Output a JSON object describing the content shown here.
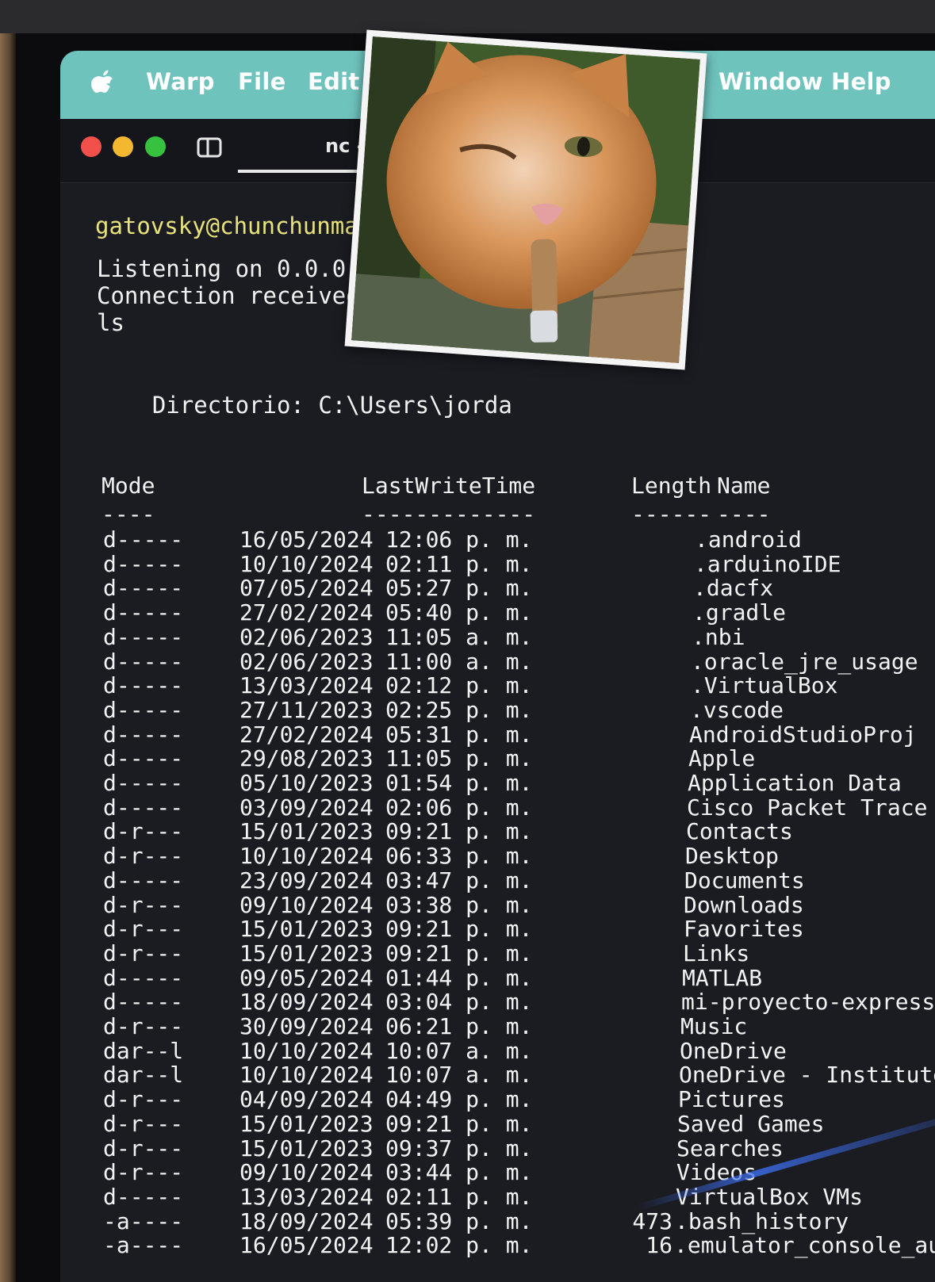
{
  "menubar": {
    "apple_icon": "apple-logo-icon",
    "items": [
      "Warp",
      "File",
      "Edit",
      "Window",
      "Help"
    ]
  },
  "tabbar": {
    "buttons": [
      {
        "name": "close",
        "color": "#f1514a"
      },
      {
        "name": "minimize",
        "color": "#f4b830"
      },
      {
        "name": "zoom",
        "color": "#36c13f"
      }
    ],
    "split_icon": "split-pane-icon",
    "active_tab": "nc -lv"
  },
  "terminal": {
    "prompt": "gatovsky@chunchunmaru",
    "lines": [
      "Listening on 0.0.0.0",
      "Connection received",
      "ls"
    ],
    "directory": "    Directorio: C:\\Users\\jorda",
    "columns": {
      "mode": "Mode",
      "time": "LastWriteTime",
      "length": "Length",
      "name": "Name"
    },
    "separators": {
      "mode": "----",
      "time": "-------------",
      "length": "------",
      "name": "----"
    },
    "rows": [
      {
        "mode": "d-----",
        "date": "16/05/2024",
        "time": "12:06 p. m.",
        "length": "",
        "name": ".android"
      },
      {
        "mode": "d-----",
        "date": "10/10/2024",
        "time": "02:11 p. m.",
        "length": "",
        "name": ".arduinoIDE"
      },
      {
        "mode": "d-----",
        "date": "07/05/2024",
        "time": "05:27 p. m.",
        "length": "",
        "name": ".dacfx"
      },
      {
        "mode": "d-----",
        "date": "27/02/2024",
        "time": "05:40 p. m.",
        "length": "",
        "name": ".gradle"
      },
      {
        "mode": "d-----",
        "date": "02/06/2023",
        "time": "11:05 a. m.",
        "length": "",
        "name": ".nbi"
      },
      {
        "mode": "d-----",
        "date": "02/06/2023",
        "time": "11:00 a. m.",
        "length": "",
        "name": ".oracle_jre_usage"
      },
      {
        "mode": "d-----",
        "date": "13/03/2024",
        "time": "02:12 p. m.",
        "length": "",
        "name": ".VirtualBox"
      },
      {
        "mode": "d-----",
        "date": "27/11/2023",
        "time": "02:25 p. m.",
        "length": "",
        "name": ".vscode"
      },
      {
        "mode": "d-----",
        "date": "27/02/2024",
        "time": "05:31 p. m.",
        "length": "",
        "name": "AndroidStudioProj"
      },
      {
        "mode": "d-----",
        "date": "29/08/2023",
        "time": "11:05 p. m.",
        "length": "",
        "name": "Apple"
      },
      {
        "mode": "d-----",
        "date": "05/10/2023",
        "time": "01:54 p. m.",
        "length": "",
        "name": "Application Data"
      },
      {
        "mode": "d-----",
        "date": "03/09/2024",
        "time": "02:06 p. m.",
        "length": "",
        "name": "Cisco Packet Trace"
      },
      {
        "mode": "d-r---",
        "date": "15/01/2023",
        "time": "09:21 p. m.",
        "length": "",
        "name": "Contacts"
      },
      {
        "mode": "d-r---",
        "date": "10/10/2024",
        "time": "06:33 p. m.",
        "length": "",
        "name": "Desktop"
      },
      {
        "mode": "d-----",
        "date": "23/09/2024",
        "time": "03:47 p. m.",
        "length": "",
        "name": "Documents"
      },
      {
        "mode": "d-r---",
        "date": "09/10/2024",
        "time": "03:38 p. m.",
        "length": "",
        "name": "Downloads"
      },
      {
        "mode": "d-r---",
        "date": "15/01/2023",
        "time": "09:21 p. m.",
        "length": "",
        "name": "Favorites"
      },
      {
        "mode": "d-r---",
        "date": "15/01/2023",
        "time": "09:21 p. m.",
        "length": "",
        "name": "Links"
      },
      {
        "mode": "d-----",
        "date": "09/05/2024",
        "time": "01:44 p. m.",
        "length": "",
        "name": "MATLAB"
      },
      {
        "mode": "d-----",
        "date": "18/09/2024",
        "time": "03:04 p. m.",
        "length": "",
        "name": "mi-proyecto-express"
      },
      {
        "mode": "d-r---",
        "date": "30/09/2024",
        "time": "06:21 p. m.",
        "length": "",
        "name": "Music"
      },
      {
        "mode": "dar--l",
        "date": "10/10/2024",
        "time": "10:07 a. m.",
        "length": "",
        "name": "OneDrive"
      },
      {
        "mode": "dar--l",
        "date": "10/10/2024",
        "time": "10:07 a. m.",
        "length": "",
        "name": "OneDrive - Institute"
      },
      {
        "mode": "d-r---",
        "date": "04/09/2024",
        "time": "04:49 p. m.",
        "length": "",
        "name": "Pictures"
      },
      {
        "mode": "d-r---",
        "date": "15/01/2023",
        "time": "09:21 p. m.",
        "length": "",
        "name": "Saved Games"
      },
      {
        "mode": "d-r---",
        "date": "15/01/2023",
        "time": "09:37 p. m.",
        "length": "",
        "name": "Searches"
      },
      {
        "mode": "d-r---",
        "date": "09/10/2024",
        "time": "03:44 p. m.",
        "length": "",
        "name": "Videos"
      },
      {
        "mode": "d-----",
        "date": "13/03/2024",
        "time": "02:11 p. m.",
        "length": "",
        "name": "VirtualBox VMs"
      },
      {
        "mode": "-a----",
        "date": "18/09/2024",
        "time": "05:39 p. m.",
        "length": "473",
        "name": ".bash_history"
      },
      {
        "mode": "-a----",
        "date": "16/05/2024",
        "time": "12:02 p. m.",
        "length": "16",
        "name": ".emulator_console_au"
      }
    ]
  },
  "overlay": {
    "photo_icon": "cat-photo-icon"
  }
}
